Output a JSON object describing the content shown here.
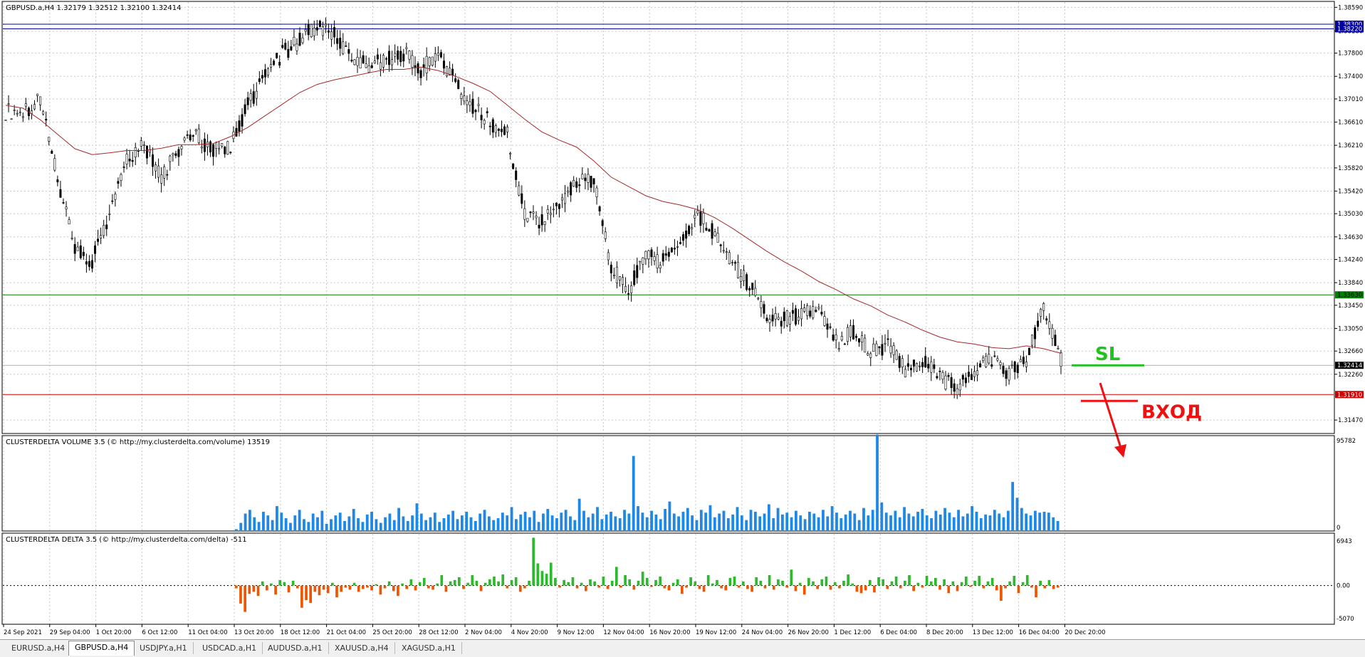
{
  "tabs": [
    {
      "label": "EURUSD.a,H4",
      "active": false
    },
    {
      "label": "GBPUSD.a,H4",
      "active": true
    },
    {
      "label": "USDJPY.a,H1",
      "active": false
    },
    {
      "label": "USDCAD.a,H1",
      "active": false
    },
    {
      "label": "AUDUSD.a,H1",
      "active": false
    },
    {
      "label": "XAUUSD.a,H4",
      "active": false
    },
    {
      "label": "XAGUSD.a,H1",
      "active": false
    }
  ],
  "colors": {
    "up_bar": "#000000",
    "moving_average": "#a52a2a",
    "resistance_line": "#0000a0",
    "support_line": "#008000",
    "entry_line": "#d00000",
    "sl_marker": "#22c022",
    "entry_marker": "#ee1111",
    "volume_bar": "#1e88e5",
    "delta_positive": "#2eb82e",
    "delta_negative": "#ee5500",
    "grid": "#c8c8c8"
  },
  "chart_data": [
    {
      "type": "line",
      "panel": "price",
      "title": "GBPUSD.a,H4  1.32179 1.32512 1.32100 1.32414",
      "x_tick_labels": [
        "24 Sep 2021",
        "29 Sep 04:00",
        "1 Oct 20:00",
        "6 Oct 12:00",
        "11 Oct 04:00",
        "13 Oct 20:00",
        "18 Oct 12:00",
        "21 Oct 04:00",
        "25 Oct 20:00",
        "28 Oct 12:00",
        "2 Nov 04:00",
        "4 Nov 20:00",
        "9 Nov 12:00",
        "12 Nov 04:00",
        "16 Nov 20:00",
        "19 Nov 12:00",
        "24 Nov 04:00",
        "26 Nov 20:00",
        "1 Dec 12:00",
        "6 Dec 04:00",
        "8 Dec 20:00",
        "13 Dec 12:00",
        "16 Dec 04:00",
        "20 Dec 20:00"
      ],
      "y_tick_labels": [
        "1.38590",
        "1.38180",
        "1.37800",
        "1.37400",
        "1.37010",
        "1.36610",
        "1.36210",
        "1.35820",
        "1.35420",
        "1.35030",
        "1.34630",
        "1.34240",
        "1.33840",
        "1.33450",
        "1.33050",
        "1.32660",
        "1.32260",
        "1.31470"
      ],
      "ylim": [
        1.3125,
        1.3868
      ],
      "x": [
        "24 Sep",
        "27 Sep",
        "28 Sep",
        "29 Sep",
        "30 Sep",
        "1 Oct",
        "4 Oct",
        "5 Oct",
        "6 Oct",
        "7 Oct",
        "8 Oct",
        "11 Oct",
        "12 Oct",
        "13 Oct",
        "14 Oct",
        "15 Oct",
        "18 Oct",
        "19 Oct",
        "20 Oct",
        "21 Oct",
        "22 Oct",
        "25 Oct",
        "26 Oct",
        "27 Oct",
        "28 Oct",
        "29 Oct",
        "1 Nov",
        "2 Nov",
        "3 Nov",
        "4 Nov",
        "5 Nov",
        "8 Nov",
        "9 Nov",
        "10 Nov",
        "11 Nov",
        "12 Nov",
        "15 Nov",
        "16 Nov",
        "17 Nov",
        "18 Nov",
        "19 Nov",
        "22 Nov",
        "23 Nov",
        "24 Nov",
        "25 Nov",
        "26 Nov",
        "29 Nov",
        "30 Nov",
        "1 Dec",
        "2 Dec",
        "3 Dec",
        "6 Dec",
        "7 Dec",
        "8 Dec",
        "9 Dec",
        "10 Dec",
        "13 Dec",
        "14 Dec",
        "15 Dec",
        "16 Dec",
        "17 Dec",
        "20 Dec"
      ],
      "series": [
        {
          "values": [
            1.368,
            1.37,
            1.356,
            1.344,
            1.342,
            1.35,
            1.36,
            1.362,
            1.357,
            1.361,
            1.364,
            1.361,
            1.362,
            1.369,
            1.374,
            1.378,
            1.38,
            1.383,
            1.381,
            1.377,
            1.376,
            1.377,
            1.378,
            1.375,
            1.378,
            1.373,
            1.369,
            1.366,
            1.364,
            1.35,
            1.349,
            1.352,
            1.356,
            1.356,
            1.341,
            1.337,
            1.343,
            1.342,
            1.346,
            1.35,
            1.347,
            1.342,
            1.338,
            1.333,
            1.332,
            1.333,
            1.333,
            1.328,
            1.33,
            1.326,
            1.328,
            1.323,
            1.325,
            1.322,
            1.32,
            1.323,
            1.325,
            1.323,
            1.325,
            1.334,
            1.325,
            1.3241
          ]
        },
        {
          "values": [
            1.369,
            1.3685,
            1.3665,
            1.364,
            1.3615,
            1.3605,
            1.3608,
            1.3612,
            1.3612,
            1.3616,
            1.3622,
            1.3622,
            1.3624,
            1.3636,
            1.3652,
            1.3672,
            1.3692,
            1.3712,
            1.3726,
            1.3734,
            1.374,
            1.3746,
            1.3752,
            1.3752,
            1.3756,
            1.375,
            1.374,
            1.3728,
            1.3714,
            1.369,
            1.3666,
            1.3644,
            1.363,
            1.3618,
            1.3594,
            1.3566,
            1.355,
            1.3534,
            1.3524,
            1.3518,
            1.351,
            1.3496,
            1.3478,
            1.3458,
            1.3438,
            1.342,
            1.3404,
            1.3386,
            1.3372,
            1.3356,
            1.3344,
            1.3328,
            1.3316,
            1.3302,
            1.329,
            1.3282,
            1.3278,
            1.3272,
            1.327,
            1.3275,
            1.327,
            1.3262
          ]
        }
      ]
    },
    {
      "type": "bar",
      "panel": "volume",
      "title": "CLUSTERDELTA VOLUME 3.5 (© http://my.clusterdelta.com/volume) 13519",
      "y_tick_labels": [
        "95782",
        "0"
      ],
      "ylim": [
        0,
        95782
      ],
      "bar_count": 187,
      "values": [
        1200,
        8000,
        18000,
        22000,
        14000,
        9000,
        20000,
        16000,
        11000,
        26000,
        19000,
        13000,
        8000,
        16000,
        22000,
        12000,
        9000,
        18000,
        14000,
        21000,
        7000,
        12000,
        16000,
        19000,
        10000,
        15000,
        23000,
        13000,
        9000,
        17000,
        20000,
        12000,
        8000,
        14000,
        18000,
        11000,
        24000,
        15000,
        10000,
        16000,
        29000,
        18000,
        11000,
        14000,
        19000,
        9000,
        13000,
        17000,
        21000,
        12000,
        16000,
        20000,
        14000,
        10000,
        18000,
        22000,
        15000,
        11000,
        13000,
        19000,
        16000,
        25000,
        12000,
        17000,
        20000,
        14000,
        21000,
        9000,
        18000,
        23000,
        16000,
        13000,
        19000,
        22000,
        15000,
        11000,
        34000,
        21000,
        14000,
        18000,
        25000,
        12000,
        17000,
        20000,
        15000,
        13000,
        22000,
        18000,
        80000,
        26000,
        19000,
        14000,
        21000,
        17000,
        12000,
        23000,
        31000,
        18000,
        15000,
        20000,
        24000,
        16000,
        11000,
        22000,
        19000,
        27000,
        14000,
        18000,
        21000,
        13000,
        17000,
        25000,
        16000,
        11000,
        22000,
        20000,
        15000,
        18000,
        28000,
        13000,
        24000,
        17000,
        19000,
        14000,
        21000,
        16000,
        12000,
        20000,
        18000,
        14000,
        22000,
        15000,
        26000,
        19000,
        13000,
        17000,
        21000,
        18000,
        11000,
        24000,
        16000,
        22000,
        103000,
        30000,
        19000,
        16000,
        21000,
        14000,
        25000,
        18000,
        15000,
        20000,
        23000,
        16000,
        13000,
        21000,
        17000,
        24000,
        19000,
        14000,
        22000,
        15000,
        18000,
        26000,
        20000,
        13000,
        17000,
        16000,
        22000,
        18000,
        14000,
        21000,
        52000,
        35000,
        24000,
        18000,
        16000,
        21000,
        19000,
        20000,
        19000,
        14000,
        10000
      ]
    },
    {
      "type": "bar",
      "panel": "delta",
      "title": "CLUSTERDELTA DELTA 3.5 (© http://my.clusterdelta.com/delta) -511",
      "y_tick_labels": [
        "6943",
        "0.00",
        "-5070"
      ],
      "ylim": [
        -5070,
        6943
      ],
      "values": [
        -400,
        -2600,
        -3800,
        -1200,
        -900,
        -1500,
        600,
        -700,
        300,
        -1300,
        800,
        500,
        -1000,
        700,
        -400,
        -3200,
        -2100,
        -2500,
        -900,
        -1400,
        -600,
        -1100,
        400,
        -1700,
        -900,
        -300,
        -600,
        400,
        -900,
        -500,
        -300,
        -700,
        200,
        -1300,
        -400,
        600,
        -800,
        -1500,
        300,
        -500,
        900,
        -700,
        500,
        1100,
        -400,
        -600,
        300,
        1500,
        -900,
        600,
        800,
        1200,
        -500,
        400,
        1500,
        700,
        -800,
        400,
        900,
        1300,
        600,
        1600,
        -400,
        800,
        1200,
        -900,
        -400,
        700,
        6900,
        3200,
        2100,
        1700,
        3300,
        1100,
        -300,
        800,
        500,
        1200,
        -400,
        400,
        -800,
        900,
        600,
        -300,
        1300,
        -500,
        700,
        2700,
        -300,
        1500,
        900,
        -600,
        700,
        2000,
        1100,
        -200,
        800,
        1300,
        -400,
        -700,
        400,
        900,
        -1200,
        -300,
        1200,
        600,
        -500,
        -900,
        1500,
        300,
        800,
        -400,
        -700,
        1100,
        1300,
        -300,
        600,
        -500,
        -900,
        1200,
        700,
        -400,
        1500,
        -600,
        900,
        700,
        -300,
        2300,
        -800,
        400,
        -1300,
        1100,
        600,
        -500,
        900,
        1300,
        -600,
        500,
        -400,
        700,
        1600,
        300,
        -900,
        -1100,
        -700,
        800,
        -1000,
        1200,
        900,
        -500,
        600,
        1300,
        -400,
        700,
        1500,
        -800,
        400,
        -300,
        1400,
        600,
        1100,
        -600,
        900,
        -1100,
        600,
        -800,
        500,
        1300,
        -200,
        700,
        1400,
        -400,
        600,
        1100,
        -700,
        -2200,
        -400,
        600,
        1400,
        -1100,
        500,
        1500,
        -300,
        -1700,
        700,
        -400,
        800,
        -500,
        -300
      ]
    }
  ],
  "levels": {
    "resistance_1": {
      "price": 1.383,
      "label": "1.38300"
    },
    "resistance_2": {
      "price": 1.3822,
      "label": "1.38220"
    },
    "support": {
      "price": 1.3363,
      "label": "1.33630"
    },
    "current": {
      "price": 1.32414,
      "label": "1.32414"
    },
    "entry": {
      "price": 1.3191,
      "label": "1.31910"
    }
  },
  "annotations": {
    "sl": "SL",
    "entry": "ВХОД"
  }
}
